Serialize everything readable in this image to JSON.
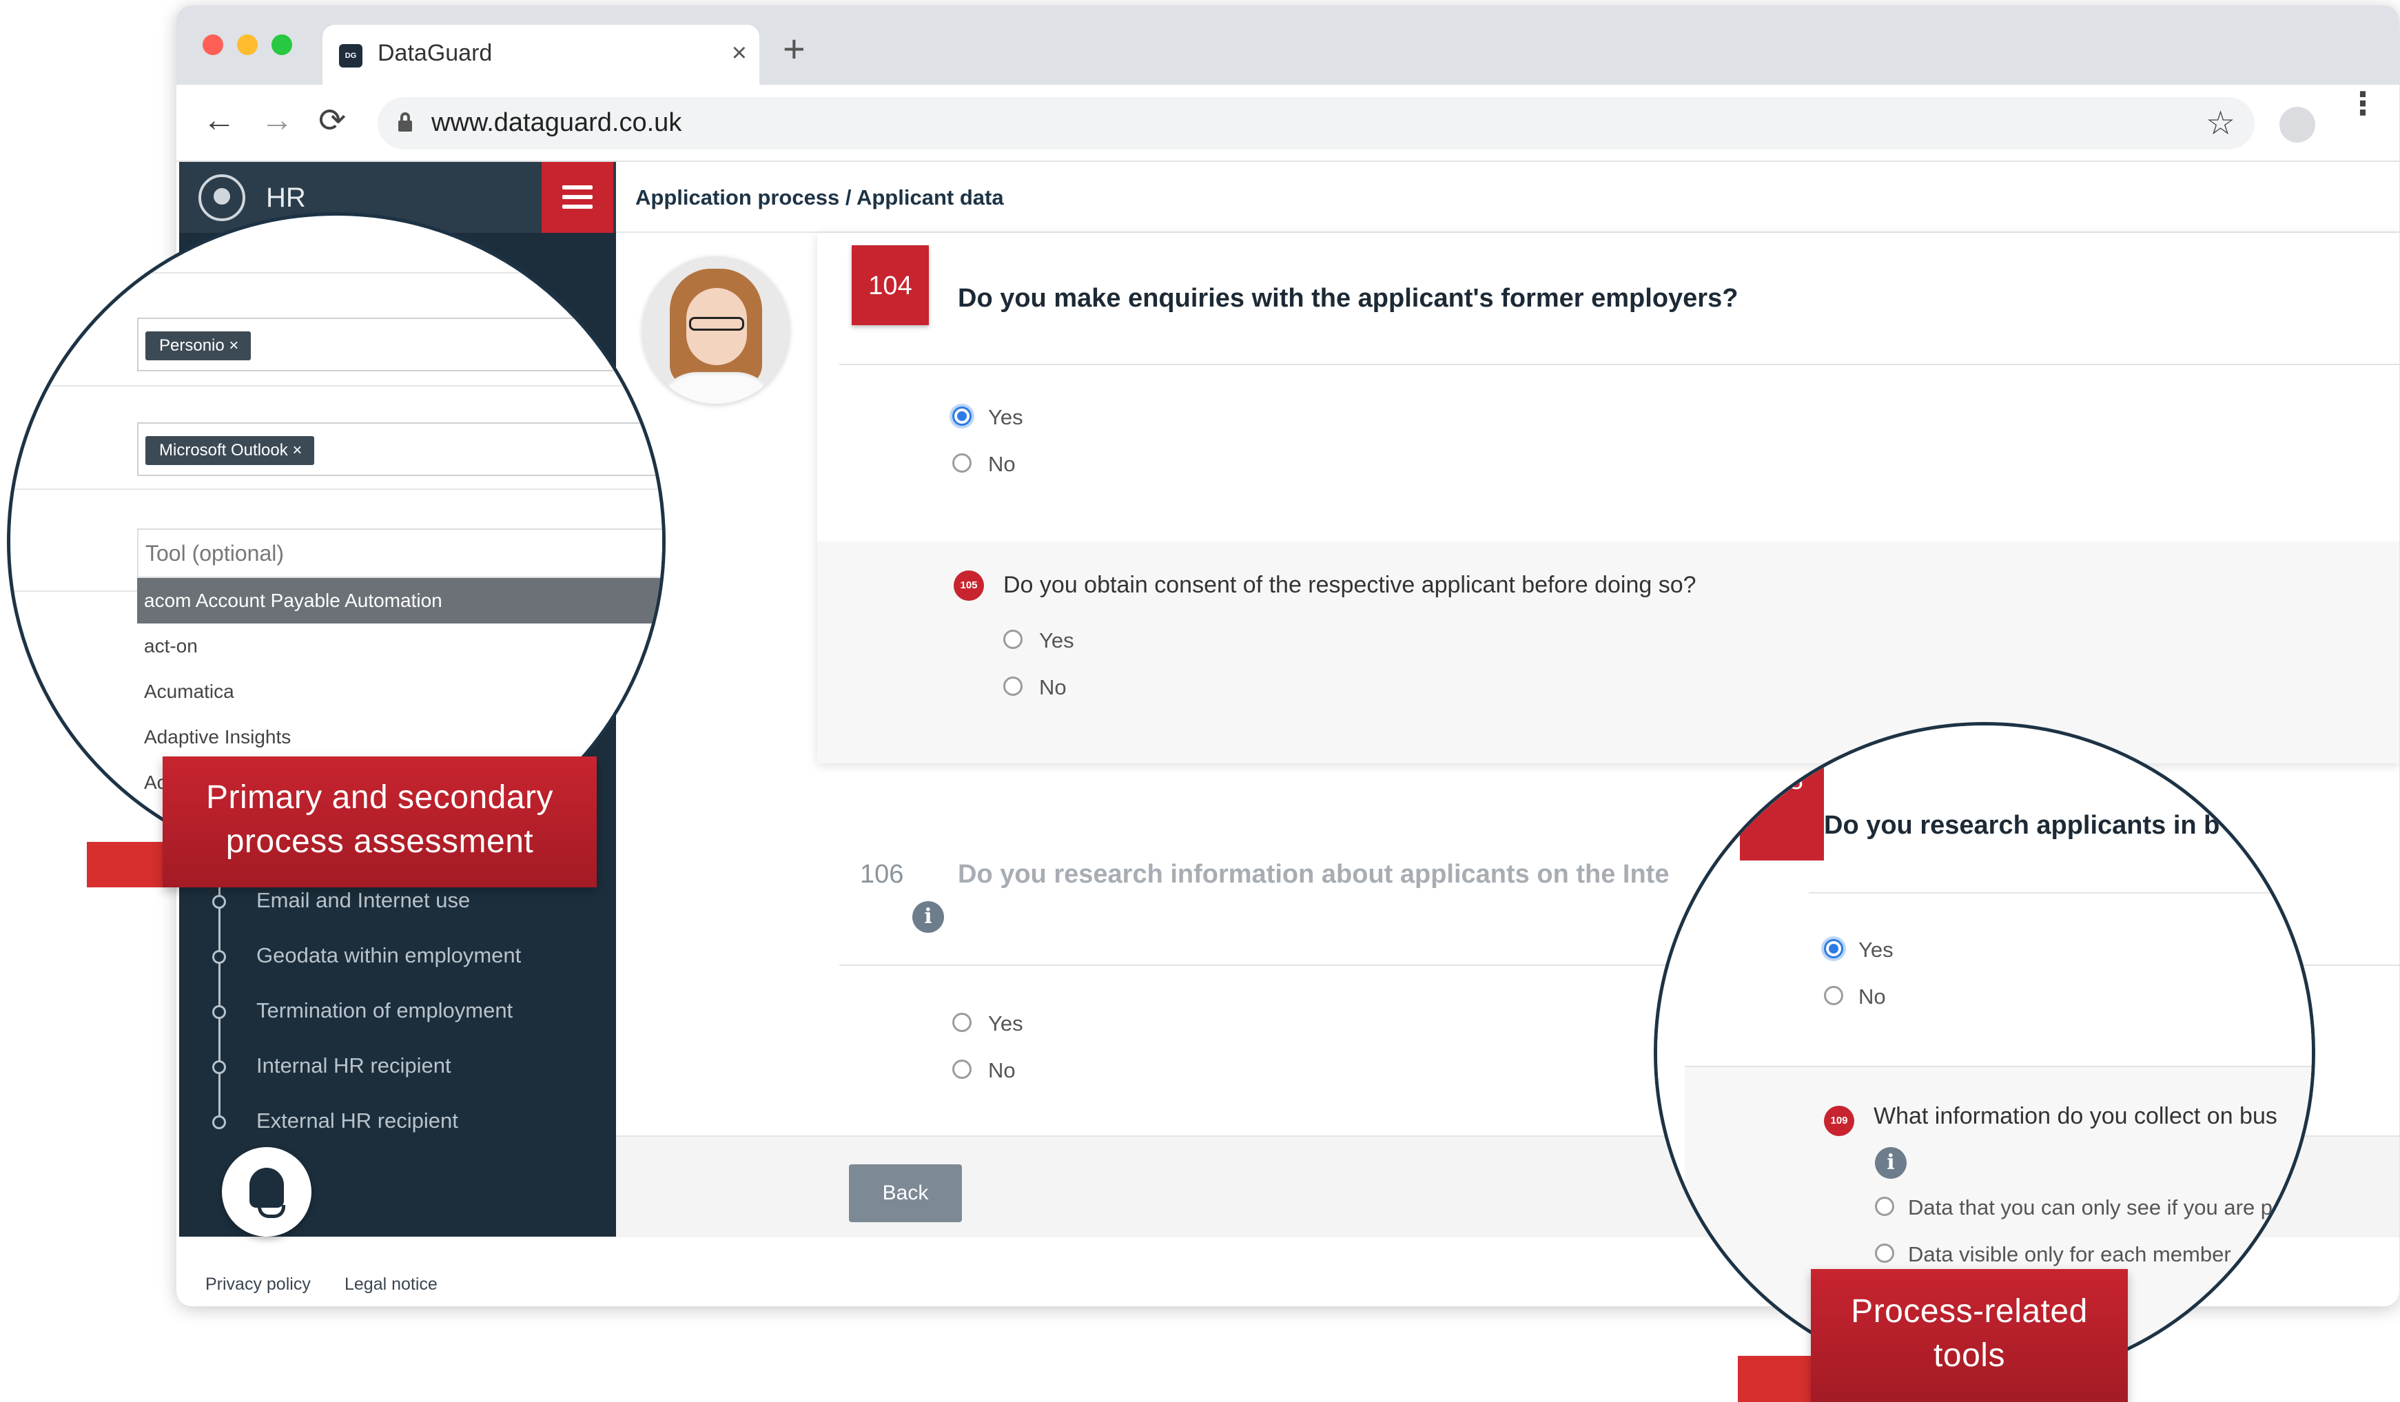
{
  "browser": {
    "tab_title": "DataGuard",
    "favicon_text": "DG",
    "close_glyph": "×",
    "new_tab_glyph": "+",
    "url": "www.dataguard.co.uk",
    "back_glyph": "←",
    "forward_glyph": "→",
    "reload_glyph": "⟳",
    "star_glyph": "☆",
    "menu_glyph": "⋮"
  },
  "sidebar": {
    "title": "HR",
    "steps": [
      {
        "label": "Email and Internet use"
      },
      {
        "label": "Geodata within employment"
      },
      {
        "label": "Termination of employment"
      },
      {
        "label": "Internal HR recipient"
      },
      {
        "label": "External HR recipient"
      }
    ]
  },
  "breadcrumb": "Application process / Applicant data",
  "q104": {
    "number": "104",
    "text": "Do you make enquiries with the applicant's former employers?",
    "options": [
      "Yes",
      "No"
    ],
    "selected": "Yes"
  },
  "q105": {
    "number": "105",
    "text": "Do you obtain consent of the respective applicant before doing so?",
    "options": [
      "Yes",
      "No"
    ]
  },
  "q106": {
    "number": "106",
    "text": "Do you research information about applicants on the Inte",
    "info_glyph": "i",
    "options": [
      "Yes",
      "No"
    ]
  },
  "buttons": {
    "back": "Back"
  },
  "footer": {
    "privacy": "Privacy policy",
    "legal": "Legal notice"
  },
  "zoom_left": {
    "tag_1": "Personio",
    "tag_2": "Microsoft Outlook",
    "tag_remove": "×",
    "tool_placeholder": "Tool (optional)",
    "options": [
      "acom Account Payable Automation",
      "act-on",
      "Acumatica",
      "Adaptive Insights",
      "Ac"
    ]
  },
  "zoom_right": {
    "badge_fragment": "8",
    "question": "Do you research applicants in b",
    "options": [
      "Yes",
      "No"
    ],
    "selected": "Yes",
    "sub_number": "109",
    "sub_question": "What information do you collect on bus",
    "info_glyph": "i",
    "sub_options": [
      "Data that you can only see if you are p",
      "Data visible only for each member"
    ]
  },
  "labels": {
    "left_line1": "Primary and secondary",
    "left_line2": "process assessment",
    "right_line1": "Process-related",
    "right_line2": "tools"
  },
  "colors": {
    "brand_red": "#c8242f",
    "sidebar_navy": "#1c2e3c",
    "accent_blue": "#2d7be4"
  }
}
